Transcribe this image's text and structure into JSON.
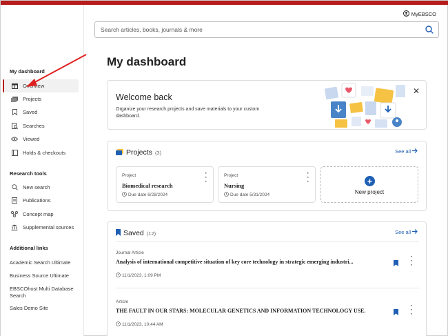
{
  "header": {
    "account_label": "MyEBSCO"
  },
  "search": {
    "placeholder": "Search articles, books, journals & more"
  },
  "sidebar": {
    "dashboard_heading": "My dashboard",
    "dashboard_items": [
      {
        "label": "Overview",
        "icon": "overview-icon",
        "active": true
      },
      {
        "label": "Projects",
        "icon": "folders-icon"
      },
      {
        "label": "Saved",
        "icon": "bookmark-icon"
      },
      {
        "label": "Searches",
        "icon": "search-history-icon"
      },
      {
        "label": "Viewed",
        "icon": "eye-icon"
      },
      {
        "label": "Holds & checkouts",
        "icon": "book-icon"
      }
    ],
    "research_heading": "Research tools",
    "research_items": [
      {
        "label": "New search",
        "icon": "search-icon"
      },
      {
        "label": "Publications",
        "icon": "publications-icon"
      },
      {
        "label": "Concept map",
        "icon": "concept-map-icon"
      },
      {
        "label": "Supplemental sources",
        "icon": "institution-icon"
      }
    ],
    "links_heading": "Additional links",
    "links": [
      "Academic Search Ultimate",
      "Business Source Ultimate",
      "EBSCOhost Multi Database Search",
      "Sales Demo Site"
    ]
  },
  "main": {
    "title": "My dashboard",
    "welcome": {
      "title": "Welcome back",
      "text": "Organize your research projects and save materials to your custom dashboard."
    },
    "projects": {
      "title": "Projects",
      "count": "(3)",
      "see_all": "See all",
      "items": [
        {
          "type": "Project",
          "name": "Biomedical research",
          "due": "Due date 6/28/2024"
        },
        {
          "type": "Project",
          "name": "Nursing",
          "due": "Due date 5/31/2024"
        }
      ],
      "new_label": "New project"
    },
    "saved": {
      "title": "Saved",
      "count": "(12)",
      "see_all": "See all",
      "items": [
        {
          "type": "Journal Article",
          "title": "Analysis of international competitive situation of key core technology in strategic emerging industri...",
          "date": "11/1/2023, 1:09 PM"
        },
        {
          "type": "Article",
          "title": "THE FAULT IN OUR STARS: MOLECULAR GENETICS AND INFORMATION TECHNOLOGY USE.",
          "date": "11/1/2023, 10:44 AM"
        }
      ]
    }
  },
  "colors": {
    "brand": "#b71c1c",
    "link": "#1f5fb4",
    "annotation_arrow": "#e02020"
  }
}
